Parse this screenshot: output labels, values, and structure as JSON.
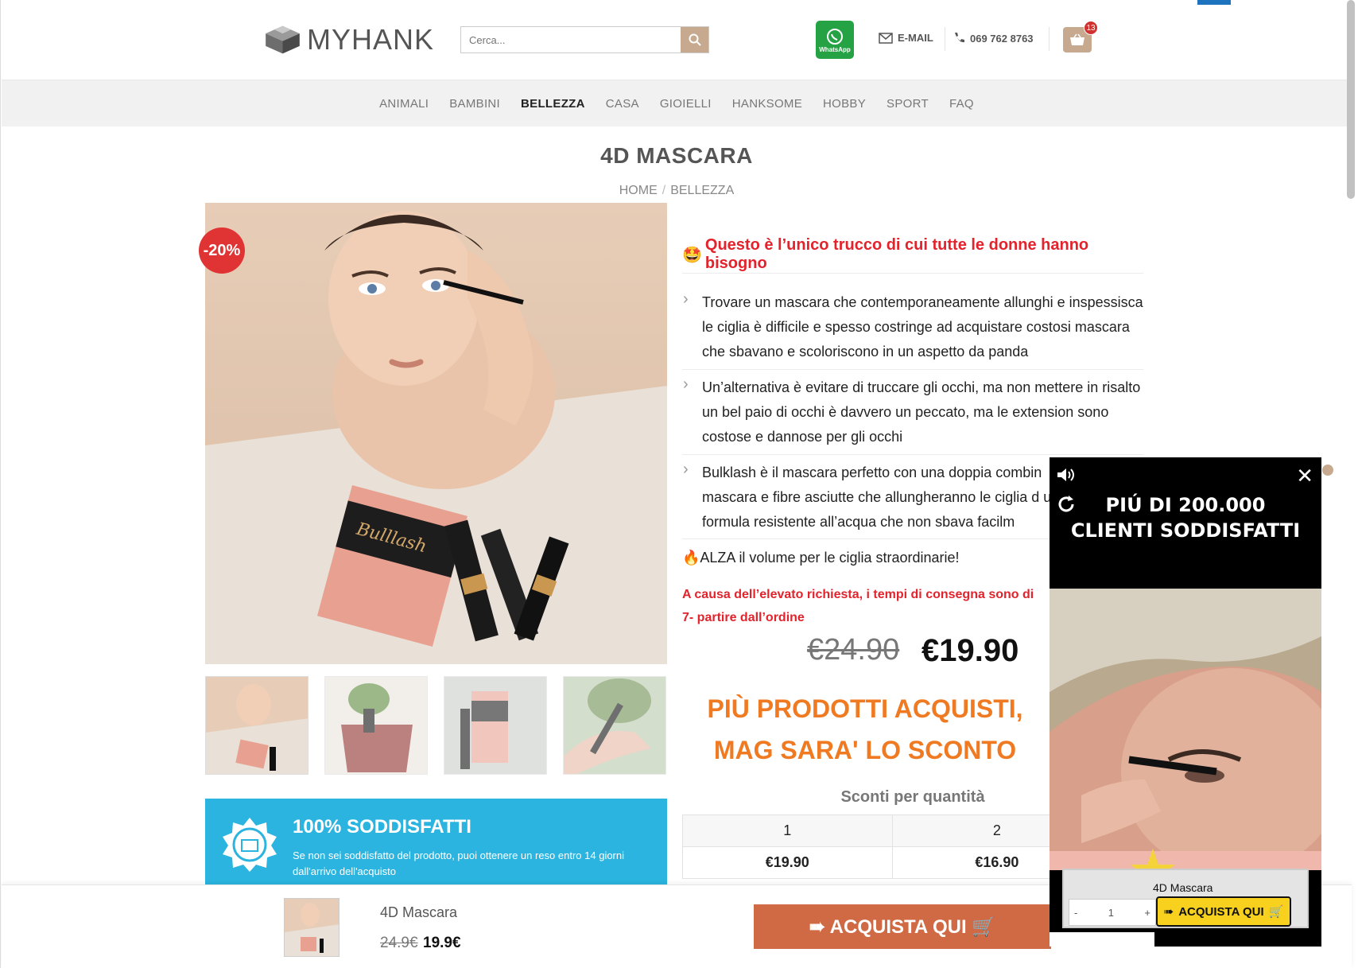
{
  "header": {
    "logo_text": "MYHANK",
    "search_placeholder": "Cerca...",
    "whatsapp_label": "WhatsApp",
    "email_label": "E-MAIL",
    "phone": "069 762 8763",
    "cart_count": "13"
  },
  "nav": {
    "items": [
      {
        "label": "ANIMALI"
      },
      {
        "label": "BAMBINI"
      },
      {
        "label": "BELLEZZA"
      },
      {
        "label": "CASA"
      },
      {
        "label": "GIOIELLI"
      },
      {
        "label": "HANKSOME"
      },
      {
        "label": "HOBBY"
      },
      {
        "label": "SPORT"
      },
      {
        "label": "FAQ"
      }
    ]
  },
  "product": {
    "title": "4D MASCARA",
    "breadcrumb": [
      "HOME",
      "BELLEZZA"
    ],
    "sale_badge": "-20%",
    "box_brand": "Bulllash",
    "headline_emoji": "🤩",
    "headline": "Questo è l’unico trucco di cui tutte le donne hanno bisogno",
    "bullets": [
      "Trovare un mascara che contemporaneamente allunghi e inspessisca le ciglia è difficile e spesso costringe ad acquistare costosi mascara che sbavano e scoloriscono in un aspetto da panda",
      "Un’alternativa è evitare di truccare gli occhi, ma non mettere in risalto un bel paio di occhi è davvero un peccato, ma le extension sono costose e dannose per gli occhi",
      "Bulklash è il mascara perfetto con una doppia combin mascara e fibre asciutte che allungheranno le ciglia d una formula resistente all’acqua che non sbava facilm"
    ],
    "alza": "🔥ALZA il volume per le ciglia straordinarie!",
    "delivery": "A causa dell’elevato richiesta, i tempi di consegna sono di 7- partire dall’ordine",
    "price_old": "€24.90",
    "price_new": "€19.90",
    "promo": "PIÙ PRODOTTI ACQUISTI, MAG SARA' LO SCONTO",
    "tiers_title": "Sconti per quantità",
    "tiers": {
      "qty": [
        "1",
        "2",
        ""
      ],
      "price": [
        "€19.90",
        "€16.90",
        "€"
      ]
    }
  },
  "guarantee": {
    "title": "100% SODDISFATTI",
    "text": "Se non sei soddisfatto del prodotto, puoi ottenere un reso entro 14 giorni dall'arrivo dell'acquisto"
  },
  "sticky": {
    "name": "4D Mascara",
    "price_old": "24.9€",
    "price_new": "19.9€",
    "button": "➠ ACQUISTA QUI 🛒"
  },
  "popup": {
    "title_line1": "PIÚ DI 200.000",
    "title_line2": "CLIENTI SODDISFATTI",
    "close": "✕",
    "product_name": "4D Mascara",
    "qty": "1",
    "minus": "-",
    "plus": "+",
    "buy_arrow": "➠",
    "buy_label": "ACQUISTA QUI",
    "buy_cart": "🛒"
  },
  "colors": {
    "accent_tan": "#c6a98f",
    "sale_red": "#e03333",
    "headline_red": "#e3232c",
    "promo_orange": "#f07a21",
    "guarantee_blue": "#2ab4df",
    "buy_button": "#d06a45",
    "popup_buy_yellow": "#f7d11e"
  }
}
